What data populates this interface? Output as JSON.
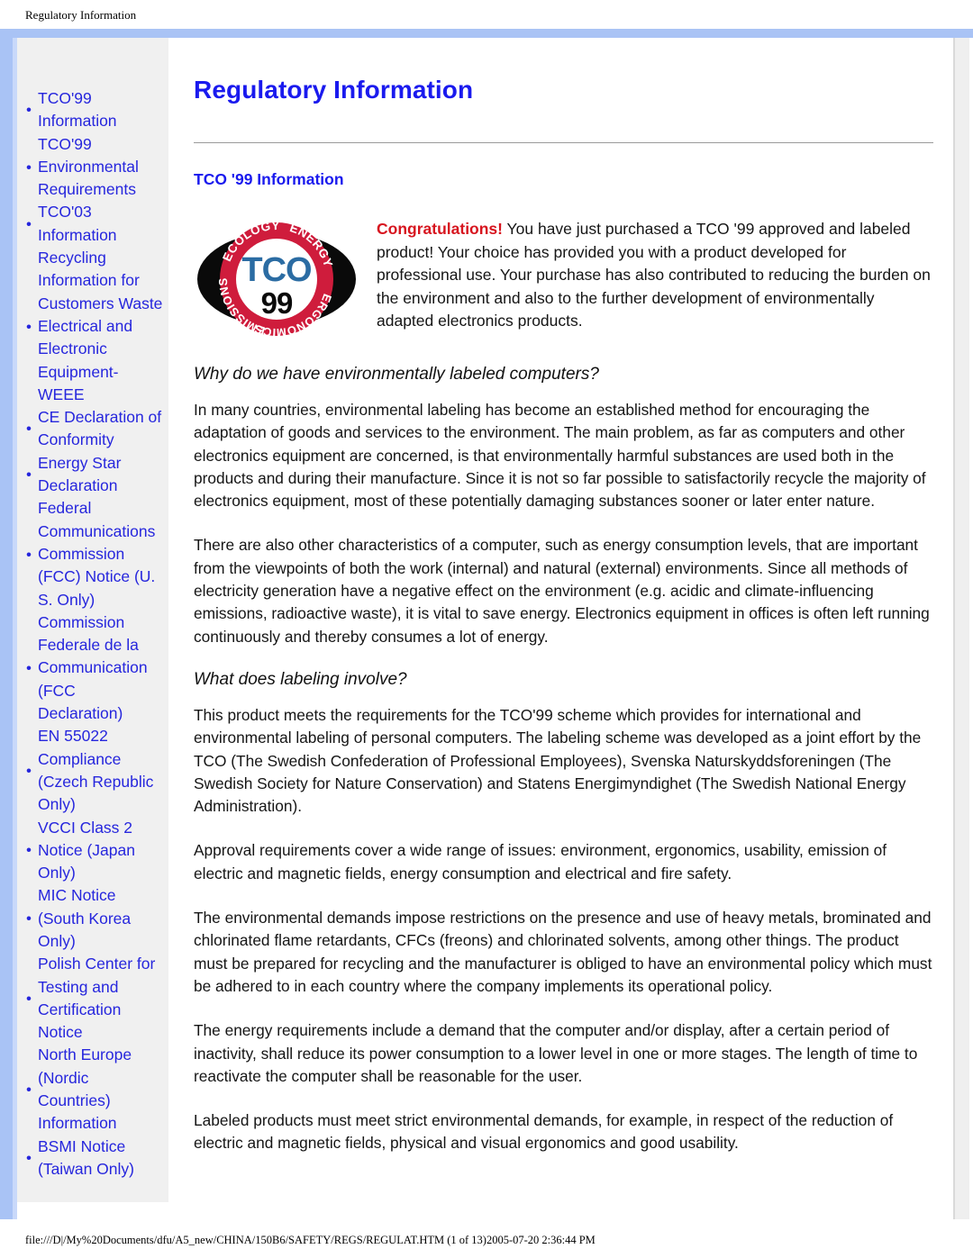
{
  "window": {
    "header_title": "Regulatory Information",
    "footer_path": "file:///D|/My%20Documents/dfu/A5_new/CHINA/150B6/SAFETY/REGS/REGULAT.HTM (1 of 13)2005-07-20 2:36:44 PM"
  },
  "colors": {
    "frame_blue": "#a9c3f5",
    "link_blue": "#2626dd",
    "title_blue": "#1a1aee",
    "sidebar_bg": "#f0f0f0",
    "accent_red": "#d7151f",
    "logo_red": "#cf1c3c",
    "logo_blue": "#2b6ca3"
  },
  "sidebar": {
    "items": [
      {
        "label": "TCO'99 Information"
      },
      {
        "label": "TCO'99 Environmental Requirements"
      },
      {
        "label": "TCO'03 Information"
      },
      {
        "label": "Recycling Information for Customers Waste Electrical and Electronic Equipment-WEEE"
      },
      {
        "label": "CE Declaration of Conformity"
      },
      {
        "label": "Energy Star Declaration"
      },
      {
        "label": "Federal Communications Commission (FCC) Notice (U. S. Only)"
      },
      {
        "label": "Commission Federale de la Communication (FCC Declaration)"
      },
      {
        "label": "EN 55022 Compliance (Czech Republic Only)"
      },
      {
        "label": "VCCI Class 2 Notice (Japan Only)"
      },
      {
        "label": "MIC Notice (South Korea Only)"
      },
      {
        "label": "Polish Center for Testing and Certification Notice"
      },
      {
        "label": "North Europe (Nordic Countries) Information"
      },
      {
        "label": "BSMI Notice (Taiwan Only)"
      }
    ],
    "bullet": "•"
  },
  "main": {
    "title": "Regulatory Information",
    "section_heading": "TCO '99 Information",
    "logo": {
      "name": "tco-99-certification-logo",
      "top_left_text": "ECOLOGY",
      "top_right_text": "ENERGY",
      "bottom_left_text": "EMISSIONS",
      "bottom_right_text": "ERGONOMICS",
      "center_text": "TCO",
      "year_text": "99"
    },
    "intro_bold": "Congratulations!",
    "intro_rest": " You have just purchased a TCO '99 approved and labeled product! Your choice has provided you with a product developed for professional use. Your purchase has also contributed to reducing the burden on the environment and also to the further development of environmentally adapted electronics products.",
    "heading_why": "Why do we have environmentally labeled computers?",
    "para_1": "In many countries, environmental labeling has become an established method for encouraging the adaptation of goods and services to the environment. The main problem, as far as computers and other electronics equipment are concerned, is that environmentally harmful substances are used both in the products and during their manufacture. Since it is not so far possible to satisfactorily recycle the majority of electronics equipment, most of these potentially damaging substances sooner or later enter nature.",
    "para_2": "There are also other characteristics of a computer, such as energy consumption levels, that are important from the viewpoints of both the work (internal) and natural (external) environments. Since all methods of electricity generation have a negative effect on the environment (e.g. acidic and climate-influencing emissions, radioactive waste), it is vital to save energy. Electronics equipment in offices is often left running continuously and thereby consumes a lot of energy.",
    "heading_what": "What does labeling involve?",
    "para_3": "This product meets the requirements for the TCO'99 scheme which provides for international and environmental labeling of personal computers. The labeling scheme was developed as a joint effort by the TCO (The Swedish Confederation of Professional Employees), Svenska Naturskyddsforeningen (The Swedish Society for Nature Conservation) and Statens Energimyndighet (The Swedish National Energy Administration).",
    "para_4": "Approval requirements cover a wide range of issues: environment, ergonomics, usability, emission of electric and magnetic fields, energy consumption and electrical and fire safety.",
    "para_5": "The environmental demands impose restrictions on the presence and use of heavy metals, brominated and chlorinated flame retardants, CFCs (freons) and chlorinated solvents, among other things. The product must be prepared for recycling and the manufacturer is obliged to have an environmental policy which must be adhered to in each country where the company implements its operational policy.",
    "para_6": "The energy requirements include a demand that the computer and/or display, after a certain period of inactivity, shall reduce its power consumption to a lower level in one or more stages. The length of time to reactivate the computer shall be reasonable for the user.",
    "para_7": "Labeled products must meet strict environmental demands, for example, in respect of the reduction of electric and magnetic fields, physical and visual ergonomics and good usability."
  }
}
